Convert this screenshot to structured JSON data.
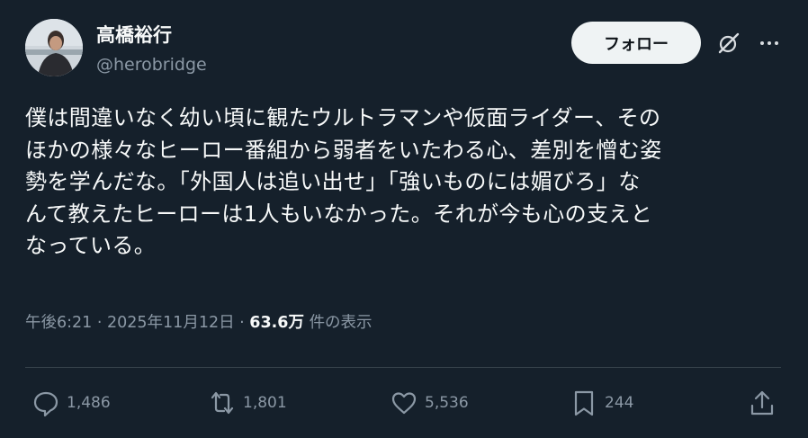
{
  "tweet": {
    "author_name": "高橋裕行",
    "author_handle": "@herobridge",
    "follow_label": "フォロー",
    "text": "僕は間違いなく幼い頃に観たウルトラマンや仮面ライダー、その\nほかの様々なヒーロー番組から弱者をいたわる心、差別を憎む姿\n勢を学んだな。「外国人は追い出せ」「強いものには媚びろ」な\nんて教えたヒーローは1人もいなかった。それが今も心の支えと\nなっている。",
    "time": "午後6:21",
    "separator": " · ",
    "date": "2025年11月12日",
    "views_count": "63.6万",
    "views_label": "件の表示"
  },
  "actions": {
    "reply_count": "1,486",
    "retweet_count": "1,801",
    "like_count": "5,536",
    "bookmark_count": "244"
  },
  "icons": {
    "reply": "reply-icon",
    "retweet": "retweet-icon",
    "like": "like-icon",
    "bookmark": "bookmark-icon",
    "share": "share-icon",
    "grok": "grok-icon",
    "more": "more-icon"
  },
  "colors": {
    "background": "#15202b",
    "text": "#f7f9f9",
    "secondary": "#8b98a5",
    "divider": "#38444d",
    "button": "#eff3f4"
  }
}
